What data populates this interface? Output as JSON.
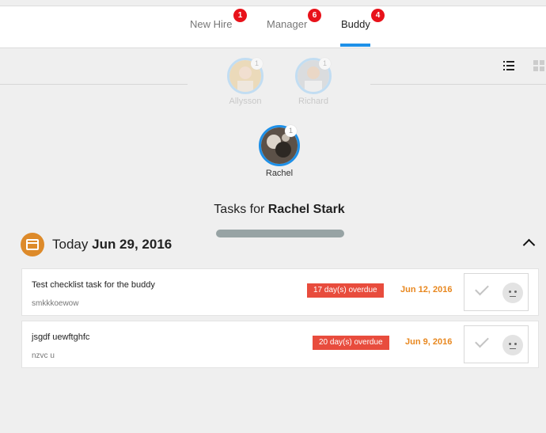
{
  "tabs": [
    {
      "label": "New Hire",
      "badge": "1"
    },
    {
      "label": "Manager",
      "badge": "6"
    },
    {
      "label": "Buddy",
      "badge": "4",
      "active": true
    }
  ],
  "view_toggle": {
    "list_icon": "list-icon",
    "grid_icon": "grid-icon"
  },
  "people": [
    {
      "name": "Allysson",
      "count": "1"
    },
    {
      "name": "Richard",
      "count": "1"
    },
    {
      "name": "Rachel",
      "count": "1",
      "selected": true
    }
  ],
  "tasks_heading": {
    "prefix": "Tasks for",
    "name": "Rachel Stark"
  },
  "progress_fraction": 0,
  "date_group": {
    "label": "Today",
    "date": "Jun 29, 2016",
    "icon": "calendar-icon"
  },
  "tasks": [
    {
      "title": "Test checklist task for the buddy",
      "subtitle": "smkkkoewow",
      "overdue": "17 day(s) overdue",
      "due": "Jun 12, 2016"
    },
    {
      "title": "jsgdf uewftghfc",
      "subtitle": "nzvc u",
      "overdue": "20 day(s) overdue",
      "due": "Jun 9, 2016"
    }
  ],
  "colors": {
    "accent": "#1e90e8",
    "badge": "#e8121a",
    "overdue": "#e84c3d",
    "due": "#e8871e",
    "calendar": "#dd8a2a"
  }
}
